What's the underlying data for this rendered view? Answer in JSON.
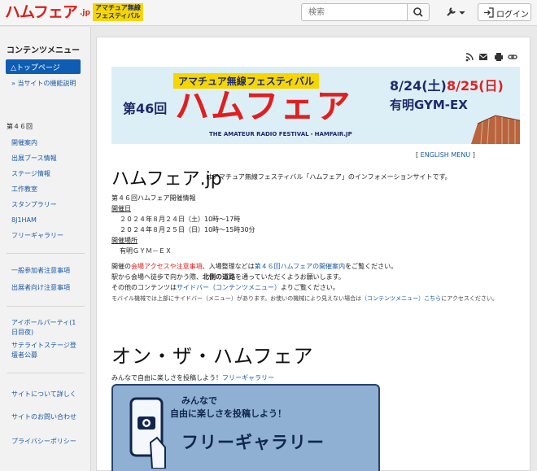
{
  "header": {
    "logo_main": "ハムフェア",
    "logo_jp": ".jp",
    "logo_sub": "アマチュア無線フェスティバル",
    "search_placeholder": "検索",
    "login_label": "ログイン"
  },
  "sidebar": {
    "title": "コンテンツメニュー",
    "active_item": "△トップページ",
    "site_features": "» 当サイトの機能説明",
    "section46": "第４６回",
    "items": [
      "開催案内",
      "出展ブース情報",
      "ステージ情報",
      "工作教室",
      "スタンプラリー",
      "8J1HAM",
      "フリーギャラリー"
    ],
    "notices": [
      "一般参加者注意事項",
      "出展者向け注意事項"
    ],
    "events": [
      "アイボールパーティ(1日目夜)",
      "サテライトステージ登壇者公募"
    ],
    "footer": [
      "サイトについて詳しく",
      "サイトのお問い合わせ",
      "プライバシーポリシー"
    ]
  },
  "banner": {
    "top": "アマチュア無線フェスティバル",
    "edition": "第46回",
    "main": "ハムフェア",
    "sub": "THE AMATEUR RADIO FESTIVAL・HAMFAIR.JP",
    "date1": "8/24(土)",
    "date2": "8/25(日)",
    "venue": "有明GYM-EX"
  },
  "main": {
    "english_open": "[ ",
    "english_link": "ENGLISH MENU",
    "english_close": " ]",
    "title": "ハムフェア.jp",
    "title_desc": "はアマチュア無線フェスティバル「ハムフェア」のインフォメーションサイトです。",
    "info_head": "第４６回ハムフェア開催情報",
    "date_label": "開催日",
    "date1": "２０２４年８月２４日（土）10時〜17時",
    "date2": "２０２４年８月２５日（日）10時〜15時30分",
    "place_label": "開催場所",
    "place": "有明ＧＹＭ－ＥＸ",
    "p1a": "開催の",
    "p1_link1": "会場アクセスや注意事項",
    "p1b": "、入場整理などは",
    "p1_link2": "第４６回ハムフェアの開催案内",
    "p1c": "をご覧ください。",
    "p2a": "駅から会場へ徒歩で向かう際、",
    "p2_bold": "北側の道路",
    "p2b": "を通っていただくようお願いします。",
    "p3a": "その他のコンテンツは",
    "p3_link": "サイドバー（コンテンツメニュー）",
    "p3b": "よりご覧ください。",
    "p4a": "モバイル機械では上部にサイドバー（メニュー）があります。お使いの機械により見えない場合は",
    "p4_link": "（コンテンツメニュー）こちら",
    "p4b": "にアクセスください。",
    "section_title": "オン・ザ・ハムフェア",
    "free_text": "みんなで自由に楽しさを投稿しよう！",
    "free_link": "フリーギャラリー"
  },
  "free_banner": {
    "line1": "みんなで",
    "line2": "自由に楽しさを投稿しよう！",
    "big": "フリーギャラリー"
  }
}
